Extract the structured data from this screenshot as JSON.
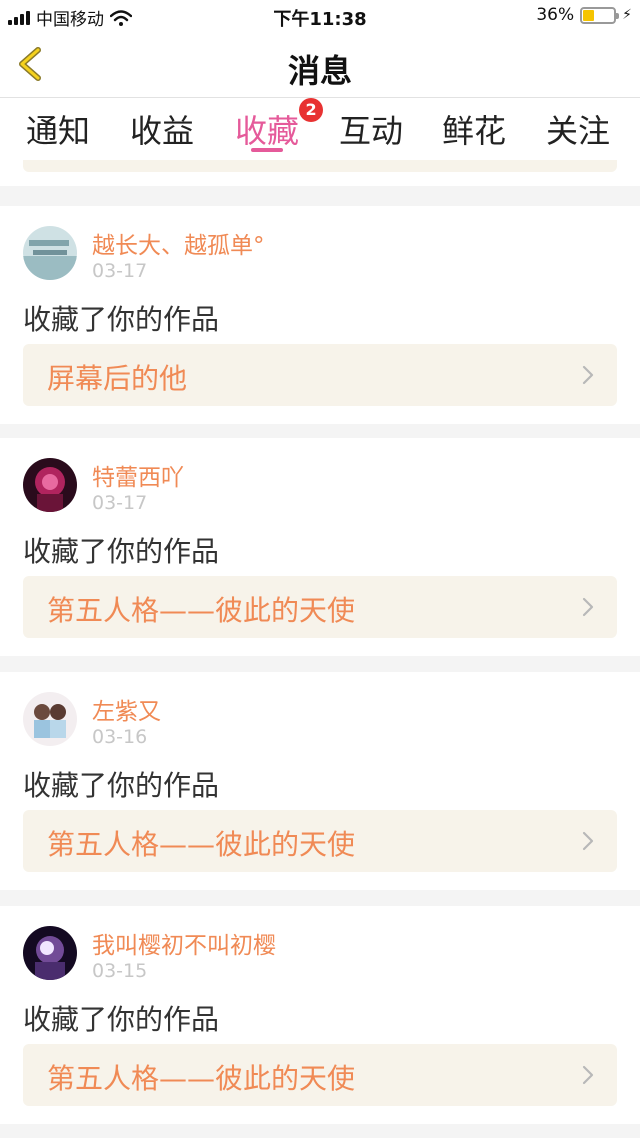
{
  "status_bar": {
    "carrier": "中国移动",
    "time": "下午11:38",
    "battery_percent": "36%",
    "battery_level": 0.36
  },
  "nav": {
    "title": "消息",
    "back_icon": "chevron-left-icon"
  },
  "tabs": [
    {
      "label": "通知",
      "active": false
    },
    {
      "label": "收益",
      "active": false
    },
    {
      "label": "收藏",
      "active": true,
      "badge": "2"
    },
    {
      "label": "互动",
      "active": false
    },
    {
      "label": "鲜花",
      "active": false
    },
    {
      "label": "关注",
      "active": false
    }
  ],
  "messages": [
    {
      "username": "越长大、越孤单°",
      "date": "03-17",
      "action": "收藏了你的作品",
      "work_title": "屏幕后的他"
    },
    {
      "username": "特蕾西吖",
      "date": "03-17",
      "action": "收藏了你的作品",
      "work_title": "第五人格——彼此的天使"
    },
    {
      "username": "左紫又",
      "date": "03-16",
      "action": "收藏了你的作品",
      "work_title": "第五人格——彼此的天使"
    },
    {
      "username": "我叫樱初不叫初樱",
      "date": "03-15",
      "action": "收藏了你的作品",
      "work_title": "第五人格——彼此的天使"
    }
  ],
  "colors": {
    "accent_pink": "#e55a9a",
    "username_orange": "#f08a55",
    "card_tint": "#f7f3ea",
    "badge_red": "#e83232"
  }
}
